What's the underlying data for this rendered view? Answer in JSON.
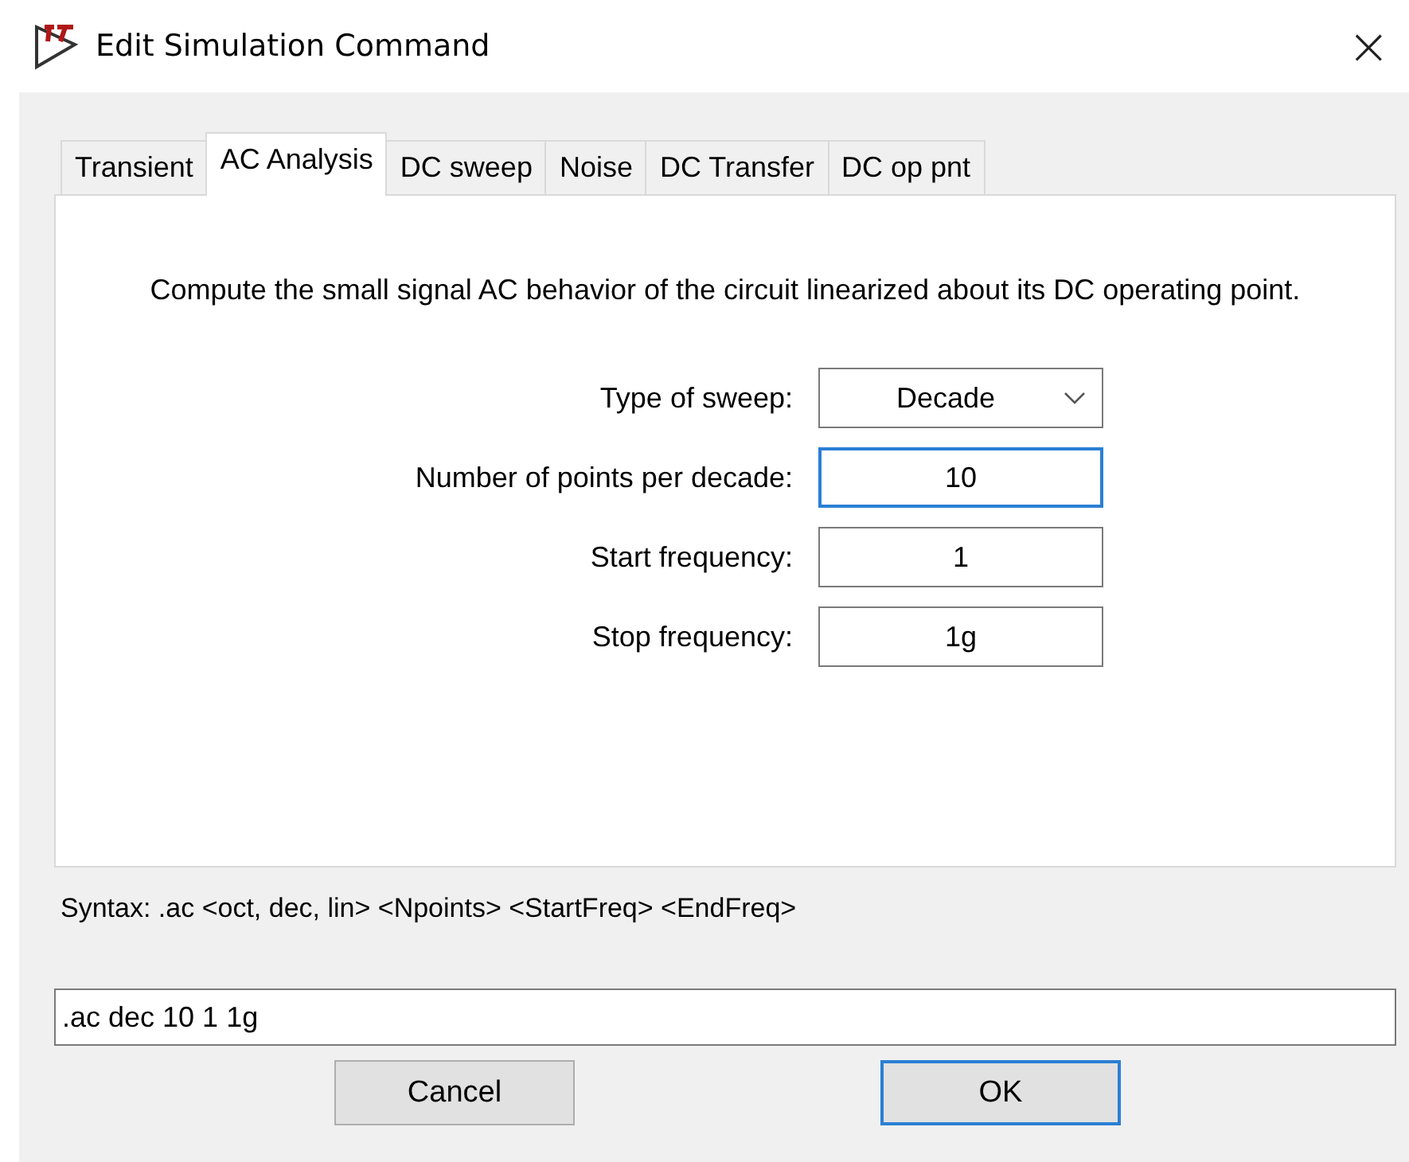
{
  "window": {
    "title": "Edit Simulation Command",
    "close": "×"
  },
  "tabs": [
    {
      "label": "Transient",
      "selected": false
    },
    {
      "label": "AC Analysis",
      "selected": true
    },
    {
      "label": "DC sweep",
      "selected": false
    },
    {
      "label": "Noise",
      "selected": false
    },
    {
      "label": "DC Transfer",
      "selected": false
    },
    {
      "label": "DC op pnt",
      "selected": false
    }
  ],
  "description": "Compute the small signal AC behavior of the circuit linearized about its DC operating point.",
  "fields": [
    {
      "label": "Type of sweep:",
      "kind": "dropdown",
      "value": "Decade",
      "focused": false
    },
    {
      "label": "Number of points per decade:",
      "kind": "text",
      "value": "10",
      "focused": true
    },
    {
      "label": "Start frequency:",
      "kind": "text",
      "value": "1",
      "focused": false
    },
    {
      "label": "Stop frequency:",
      "kind": "text",
      "value": "1g",
      "focused": false
    }
  ],
  "syntax": "Syntax:  .ac <oct, dec, lin> <Npoints> <StartFreq> <EndFreq>",
  "command": ".ac dec 10 1 1g",
  "buttons": [
    {
      "label": "Cancel",
      "default": false
    },
    {
      "label": "OK",
      "default": true
    }
  ]
}
